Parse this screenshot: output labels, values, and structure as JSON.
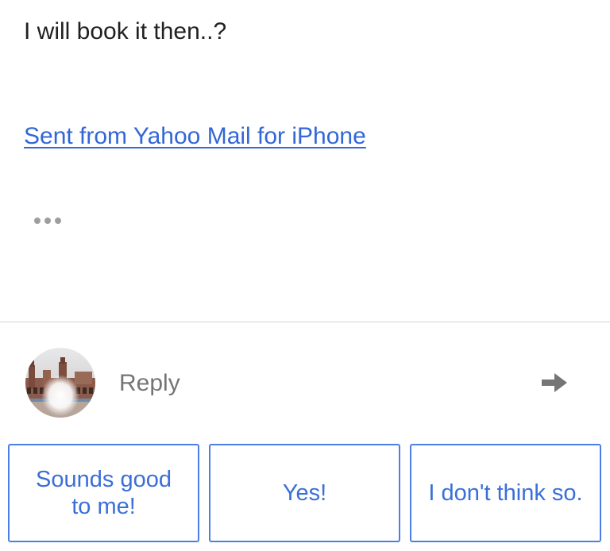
{
  "message": {
    "body_text": "I will book it then..?",
    "signature_link": "Sent from Yahoo Mail for iPhone",
    "quoted_toggle_icon": "more-horizontal-icon"
  },
  "reply": {
    "avatar_icon": "sender-avatar-photo",
    "placeholder": "Reply",
    "send_icon": "arrow-right-icon"
  },
  "smart_replies": [
    {
      "line1": "Sounds good",
      "line2": "to me!"
    },
    {
      "line1": "Yes!",
      "line2": ""
    },
    {
      "line1": "I don't think so.",
      "line2": ""
    }
  ],
  "colors": {
    "link": "#3367d6",
    "chip_border": "#4a80e5",
    "chip_text": "#3a6fd8",
    "divider": "#d4d4d4",
    "icon_grey": "#757575"
  }
}
